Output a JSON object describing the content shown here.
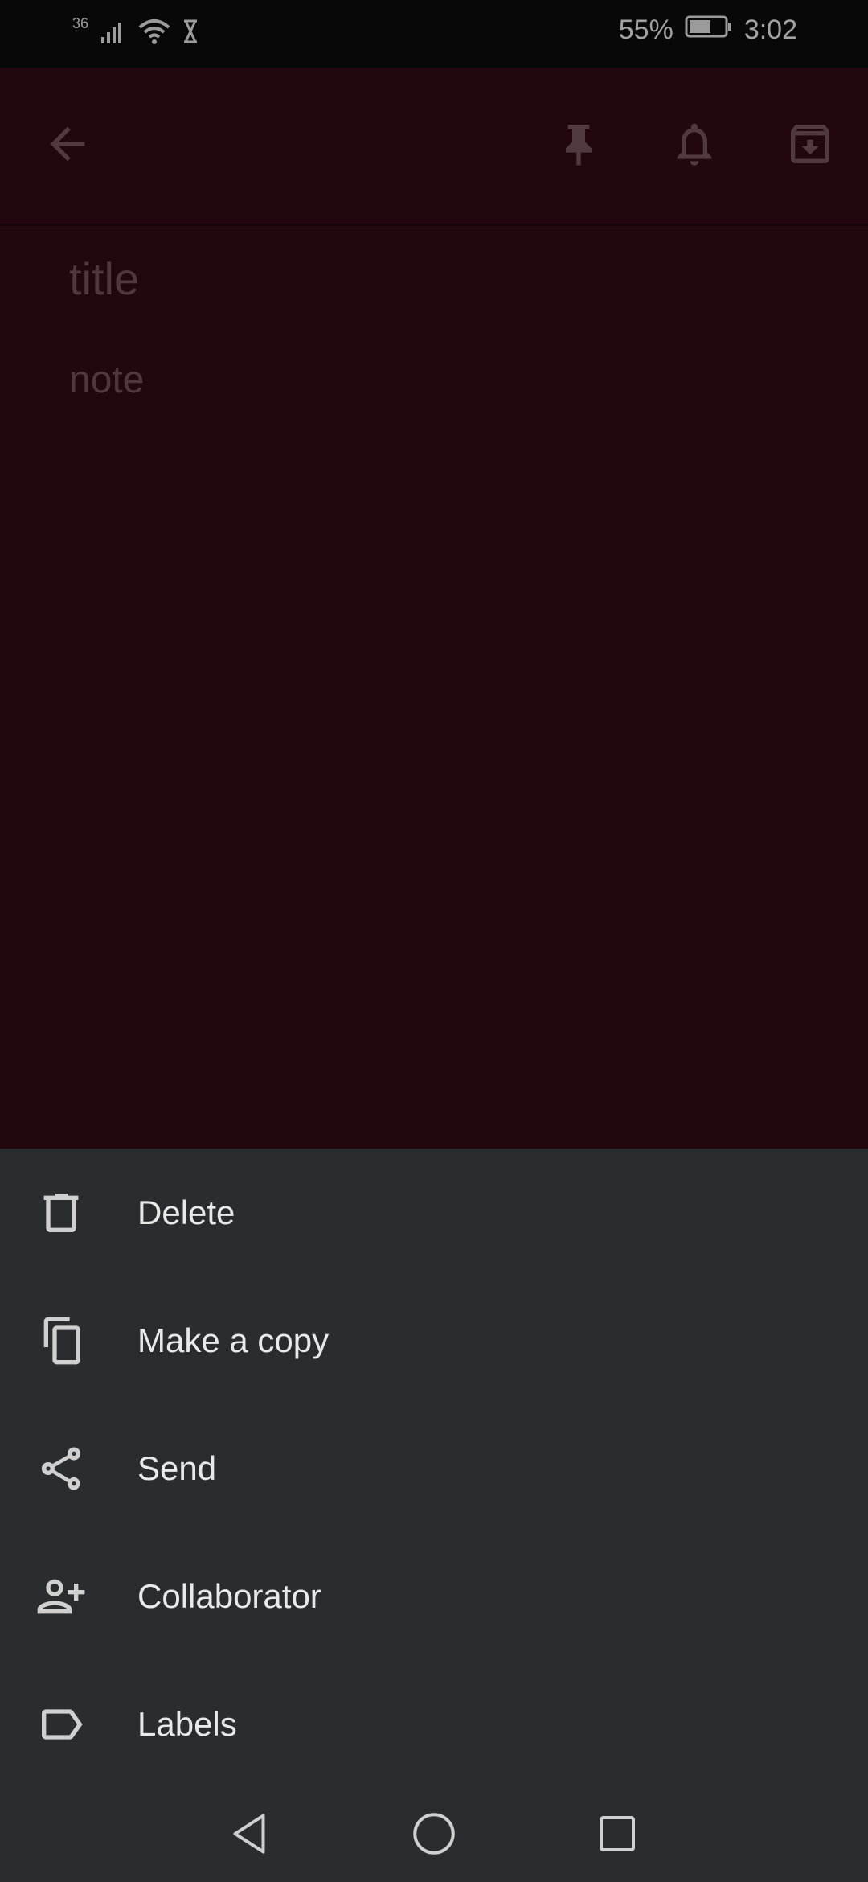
{
  "status_bar": {
    "network": "36",
    "battery": "55%",
    "time": "3:02",
    "icons": [
      "signal-icon",
      "wifi-icon",
      "hourglass-icon",
      "battery-icon"
    ]
  },
  "app_bar": {
    "icons": [
      "back-arrow-icon",
      "pin-icon",
      "bell-icon",
      "archive-icon"
    ]
  },
  "editor": {
    "title_placeholder": "title",
    "note_placeholder": "note"
  },
  "menu": {
    "items": [
      {
        "label": "Delete",
        "icon": "trash-icon"
      },
      {
        "label": "Make a copy",
        "icon": "copy-icon"
      },
      {
        "label": "Send",
        "icon": "share-icon"
      },
      {
        "label": "Collaborator",
        "icon": "add-person-icon"
      },
      {
        "label": "Labels",
        "icon": "label-icon"
      }
    ]
  },
  "colors": {
    "note_background": "#2e0a13",
    "sheet_background": "#2a2d2f",
    "status_bar": "#0b0b0c"
  }
}
